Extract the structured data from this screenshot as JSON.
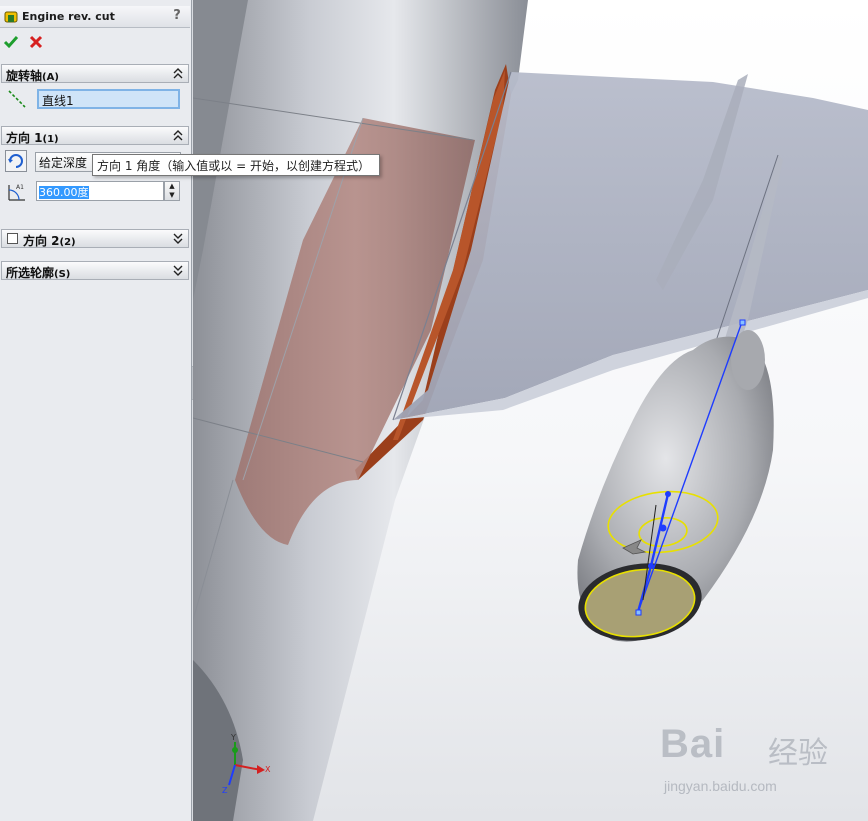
{
  "feature": {
    "title": "Engine rev. cut",
    "help": "?"
  },
  "groups": {
    "axis": {
      "label": "旋转轴",
      "key": "(A)",
      "value": "直线1"
    },
    "direction1": {
      "label": "方向 1",
      "key": "(1)",
      "end_condition": "给定深度",
      "angle": "360.00度",
      "tooltip": "方向 1 角度（输入值或以 = 开始，以创建方程式）"
    },
    "direction2": {
      "label": "方向 2",
      "key": "(2)"
    },
    "contours": {
      "label": "所选轮廓",
      "key": "(S)"
    }
  },
  "triad": {
    "x": "X",
    "y": "Y",
    "z": "Z"
  },
  "watermark": {
    "brand": "Bai",
    "brand_suffix": "经验",
    "site": "jingyan.baidu.com"
  },
  "colors": {
    "ok": "#1e9e2e",
    "cancel": "#d62020",
    "sketch": "#e8e000",
    "axis_line": "#1e3cff"
  }
}
